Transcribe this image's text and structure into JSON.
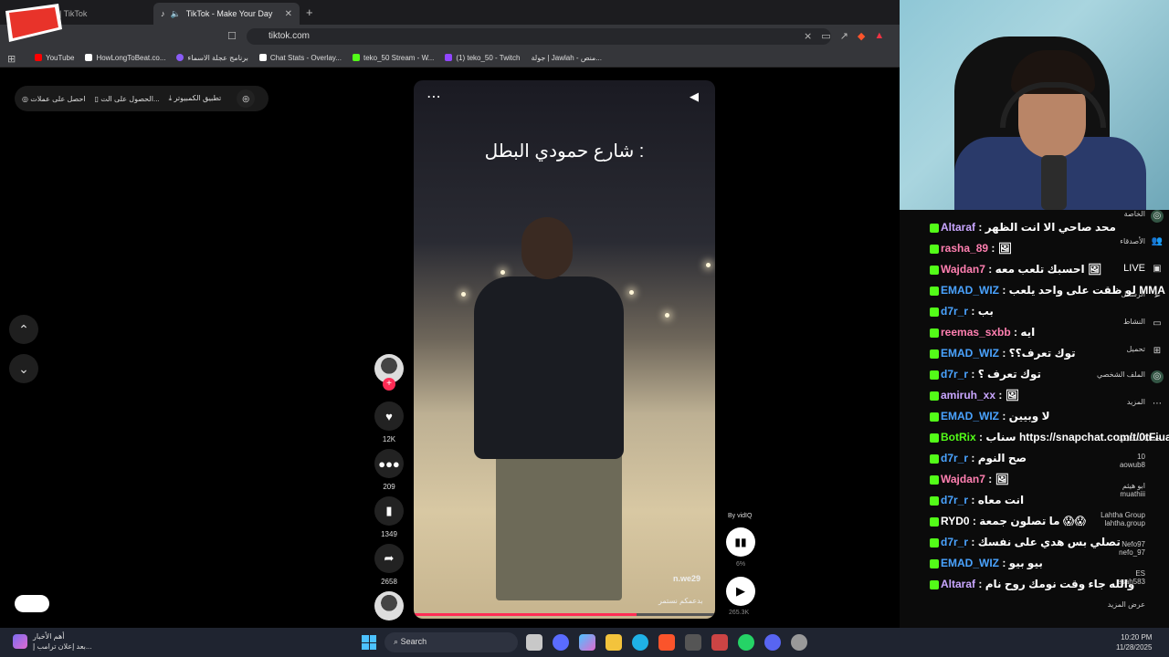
{
  "browser": {
    "tabs": [
      {
        "label": "uite | TikTok",
        "active": false
      },
      {
        "label": "TikTok - Make Your Day",
        "active": true
      }
    ],
    "url": "tiktok.com",
    "bookmarks": [
      {
        "label": "YouTube",
        "color": "#ff0000"
      },
      {
        "label": "HowLongToBeat.co...",
        "color": "#111111"
      },
      {
        "label": "برنامج عجلة الاسماء",
        "color": "#8a5cf6"
      },
      {
        "label": "Chat Stats - Overlay...",
        "color": "#ffffff"
      },
      {
        "label": "teko_50 Stream - W...",
        "color": "#53fc18"
      },
      {
        "label": "(1) teko_50 - Twitch",
        "color": "#9146ff"
      },
      {
        "label": "جولة | Jawlah - منص...",
        "color": "#444444"
      }
    ]
  },
  "logo": {
    "text": "TEKO"
  },
  "tiktok": {
    "top_buttons": [
      {
        "label": "احصل على عملات",
        "icon": "coin-icon"
      },
      {
        "label": "الحصول على الت...",
        "icon": "phone-icon"
      },
      {
        "label": "تطبيق الكمبيوتر",
        "icon": "download-icon"
      }
    ],
    "video": {
      "title": "شارع حمودي البطل :",
      "watermark": "n.we29",
      "caption": "بدعمكم نستمر",
      "progress": 0.74
    },
    "actions": {
      "likes": "12K",
      "comments": "209",
      "saves": "1349",
      "shares": "2658"
    },
    "vidiq": {
      "label": "By vidIQ",
      "percent": "6%",
      "plays": "265.3K"
    },
    "sidebar": [
      {
        "label": "الخاصة"
      },
      {
        "label": "الأصدقاء"
      },
      {
        "label": "LIVE"
      },
      {
        "label": "الرسائل"
      },
      {
        "label": "النشاط"
      },
      {
        "label": "تحميل"
      },
      {
        "label": "الملف الشخصي"
      },
      {
        "label": "المزيد"
      },
      {
        "label": "حسابات تتابعها"
      },
      {
        "label": "10",
        "sub": "aowub8"
      },
      {
        "label": "ابو هيثم",
        "sub": "muathiii"
      },
      {
        "label": "Lahtha Group",
        "sub": "lahtha.group"
      },
      {
        "label": "Nefo97",
        "sub": "nefo_97"
      },
      {
        "label": "ES",
        "sub": "esah583"
      },
      {
        "label": "عرض المزيد"
      }
    ]
  },
  "chat": [
    {
      "user": "Altaraf",
      "color": "#c9a6ff",
      "text": "محد صاحي الا انت الظهر"
    },
    {
      "user": "rasha_89",
      "color": "#ff7fb0",
      "text": "🖼"
    },
    {
      "user": "Wajdan7",
      "color": "#ff7fb0",
      "text": "احسبك تلعب معه 🖼"
    },
    {
      "user": "EMAD_WIZ",
      "color": "#4aa3ff",
      "text": "لو ظقت على واحد يلعب MMA"
    },
    {
      "user": "d7r_r",
      "color": "#4aa3ff",
      "text": "بب"
    },
    {
      "user": "reemas_sxbb",
      "color": "#ff7fb0",
      "text": "ايه"
    },
    {
      "user": "EMAD_WIZ",
      "color": "#4aa3ff",
      "text": "توك تعرف؟؟"
    },
    {
      "user": "d7r_r",
      "color": "#4aa3ff",
      "text": "توك تعرف ؟"
    },
    {
      "user": "amiruh_xx",
      "color": "#c9a6ff",
      "text": "🖼"
    },
    {
      "user": "EMAD_WIZ",
      "color": "#4aa3ff",
      "text": "لا وبيين"
    },
    {
      "user": "BotRix",
      "color": "#53fc18",
      "text": "سناب https://snapchat.com/t/0tFiua5X"
    },
    {
      "user": "d7r_r",
      "color": "#4aa3ff",
      "text": "صح النوم"
    },
    {
      "user": "Wajdan7",
      "color": "#ff7fb0",
      "text": "🖼"
    },
    {
      "user": "d7r_r",
      "color": "#4aa3ff",
      "text": "انت معاه"
    },
    {
      "user": "RYD0",
      "color": "#ffffff",
      "text": "ما تصلون جمعة 😱😱"
    },
    {
      "user": "d7r_r",
      "color": "#4aa3ff",
      "text": "تصلي بس هدي على نفسك"
    },
    {
      "user": "EMAD_WIZ",
      "color": "#4aa3ff",
      "text": "بيو بيو"
    },
    {
      "user": "Altaraf",
      "color": "#c9a6ff",
      "text": "والله جاء وقت نومك روح نام"
    }
  ],
  "taskbar": {
    "news_title": "أهم الأخبار",
    "news_sub": "بعد إعلان ترامب إ...",
    "search": "Search",
    "time": "10:20 PM",
    "date": "11/28/2025"
  }
}
